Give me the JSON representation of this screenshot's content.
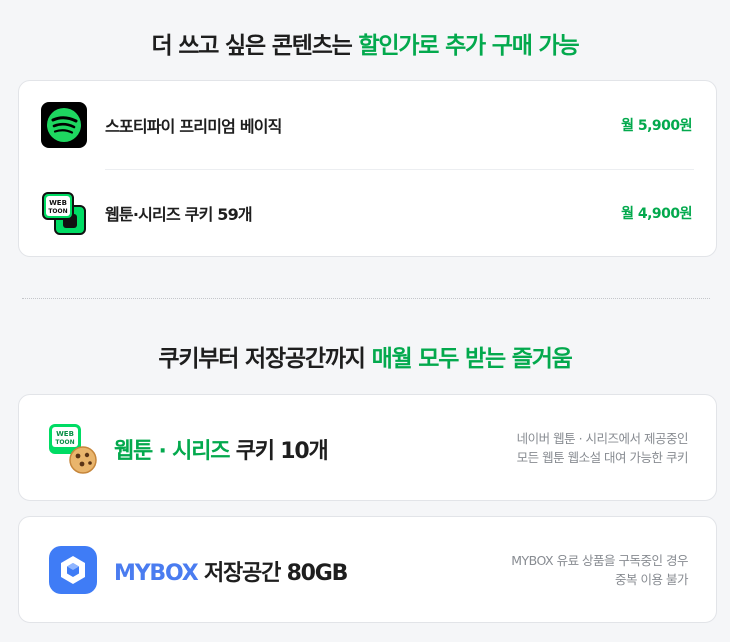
{
  "section1": {
    "heading_prefix": "더 쓰고 싶은 콘텐츠는 ",
    "heading_accent": "할인가로 추가 구매 가능",
    "items": [
      {
        "icon": "spotify-icon",
        "label": "스포티파이 프리미엄 베이직",
        "price": "월 5,900원"
      },
      {
        "icon": "webtoon-icon",
        "label": "웹툰·시리즈 쿠키 59개",
        "price": "월 4,900원"
      }
    ]
  },
  "section2": {
    "heading_prefix": "쿠키부터 저장공간까지 ",
    "heading_accent": "매월 모두 받는 즐거움",
    "benefits": [
      {
        "icon": "webtoon-cookie-icon",
        "title_accent": "웹툰 · 시리즈",
        "title_rest": " 쿠키 10개",
        "desc_line1": "네이버 웹툰 · 시리즈에서 제공중인",
        "desc_line2": "모든 웹툰 웹소설 대여 가능한 쿠키"
      },
      {
        "icon": "mybox-icon",
        "title_accent": "MYBOX",
        "title_rest": " 저장공간 80GB",
        "desc_line1": "MYBOX 유료 상품을 구독중인 경우",
        "desc_line2": "중복 이용 불가"
      }
    ]
  },
  "colors": {
    "accent_green": "#03a94d",
    "accent_blue": "#4a7cf0",
    "background": "#f5f6f8"
  }
}
